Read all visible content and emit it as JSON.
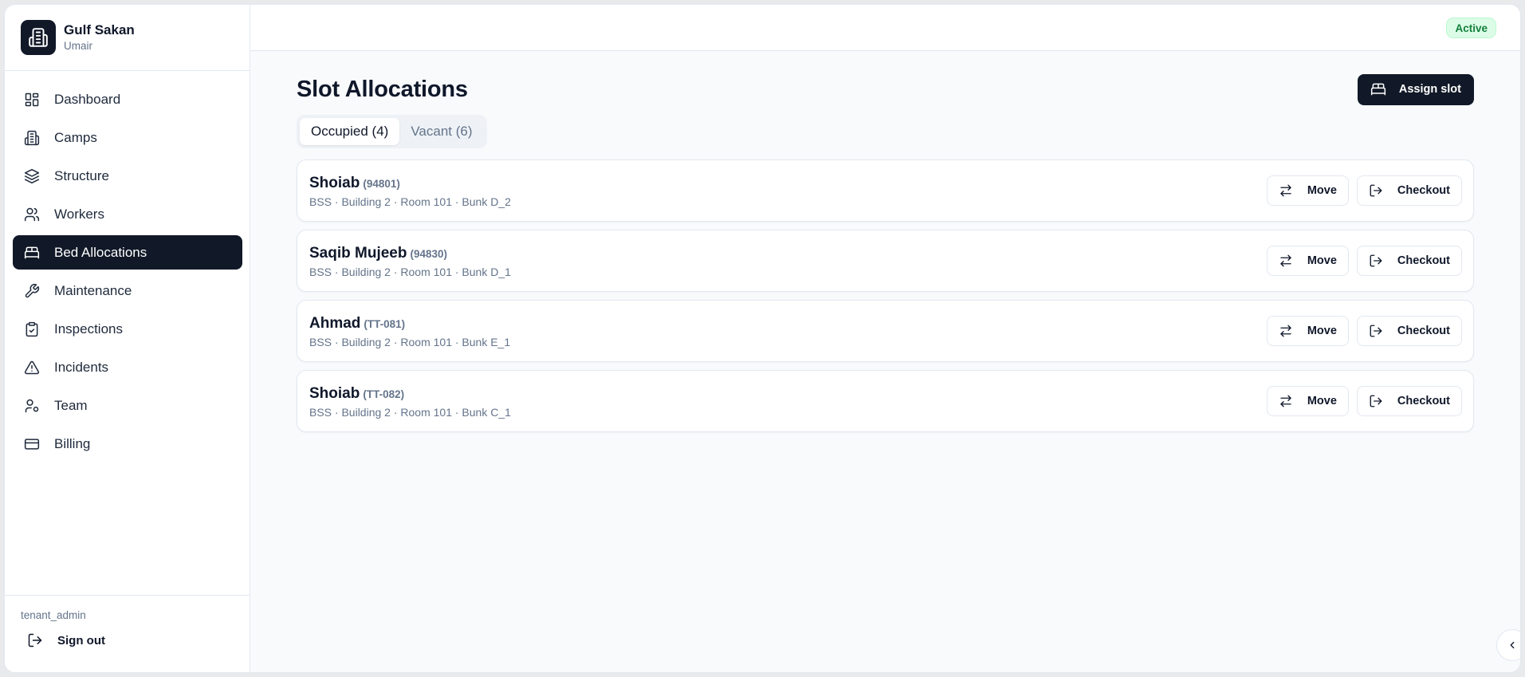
{
  "brand": {
    "name": "Gulf Sakan",
    "user": "Umair"
  },
  "nav": [
    {
      "label": "Dashboard",
      "icon": "dashboard-icon",
      "active": false
    },
    {
      "label": "Camps",
      "icon": "building-icon",
      "active": false
    },
    {
      "label": "Structure",
      "icon": "layers-icon",
      "active": false
    },
    {
      "label": "Workers",
      "icon": "users-icon",
      "active": false
    },
    {
      "label": "Bed Allocations",
      "icon": "bed-icon",
      "active": true
    },
    {
      "label": "Maintenance",
      "icon": "wrench-icon",
      "active": false
    },
    {
      "label": "Inspections",
      "icon": "clipboard-check-icon",
      "active": false
    },
    {
      "label": "Incidents",
      "icon": "warning-triangle-icon",
      "active": false
    },
    {
      "label": "Team",
      "icon": "user-cog-icon",
      "active": false
    },
    {
      "label": "Billing",
      "icon": "credit-card-icon",
      "active": false
    }
  ],
  "footer": {
    "role": "tenant_admin",
    "sign_out": "Sign out"
  },
  "topbar": {
    "status": "Active"
  },
  "page": {
    "title": "Slot Allocations",
    "assign_label": "Assign slot",
    "tabs": [
      {
        "label": "Occupied (4)",
        "active": true
      },
      {
        "label": "Vacant (6)",
        "active": false
      }
    ]
  },
  "allocations": [
    {
      "name": "Shoiab",
      "id": "(94801)",
      "location": "BSS · Building 2 · Room 101 · Bunk D_2"
    },
    {
      "name": "Saqib Mujeeb",
      "id": "(94830)",
      "location": "BSS · Building 2 · Room 101 · Bunk D_1"
    },
    {
      "name": "Ahmad",
      "id": "(TT-081)",
      "location": "BSS · Building 2 · Room 101 · Bunk E_1"
    },
    {
      "name": "Shoiab",
      "id": "(TT-082)",
      "location": "BSS · Building 2 · Room 101 · Bunk C_1"
    }
  ],
  "actions": {
    "move": "Move",
    "checkout": "Checkout"
  },
  "colors": {
    "primary": "#111827",
    "status_bg": "#dcfce7",
    "status_text": "#15803d",
    "muted": "#64748b"
  }
}
